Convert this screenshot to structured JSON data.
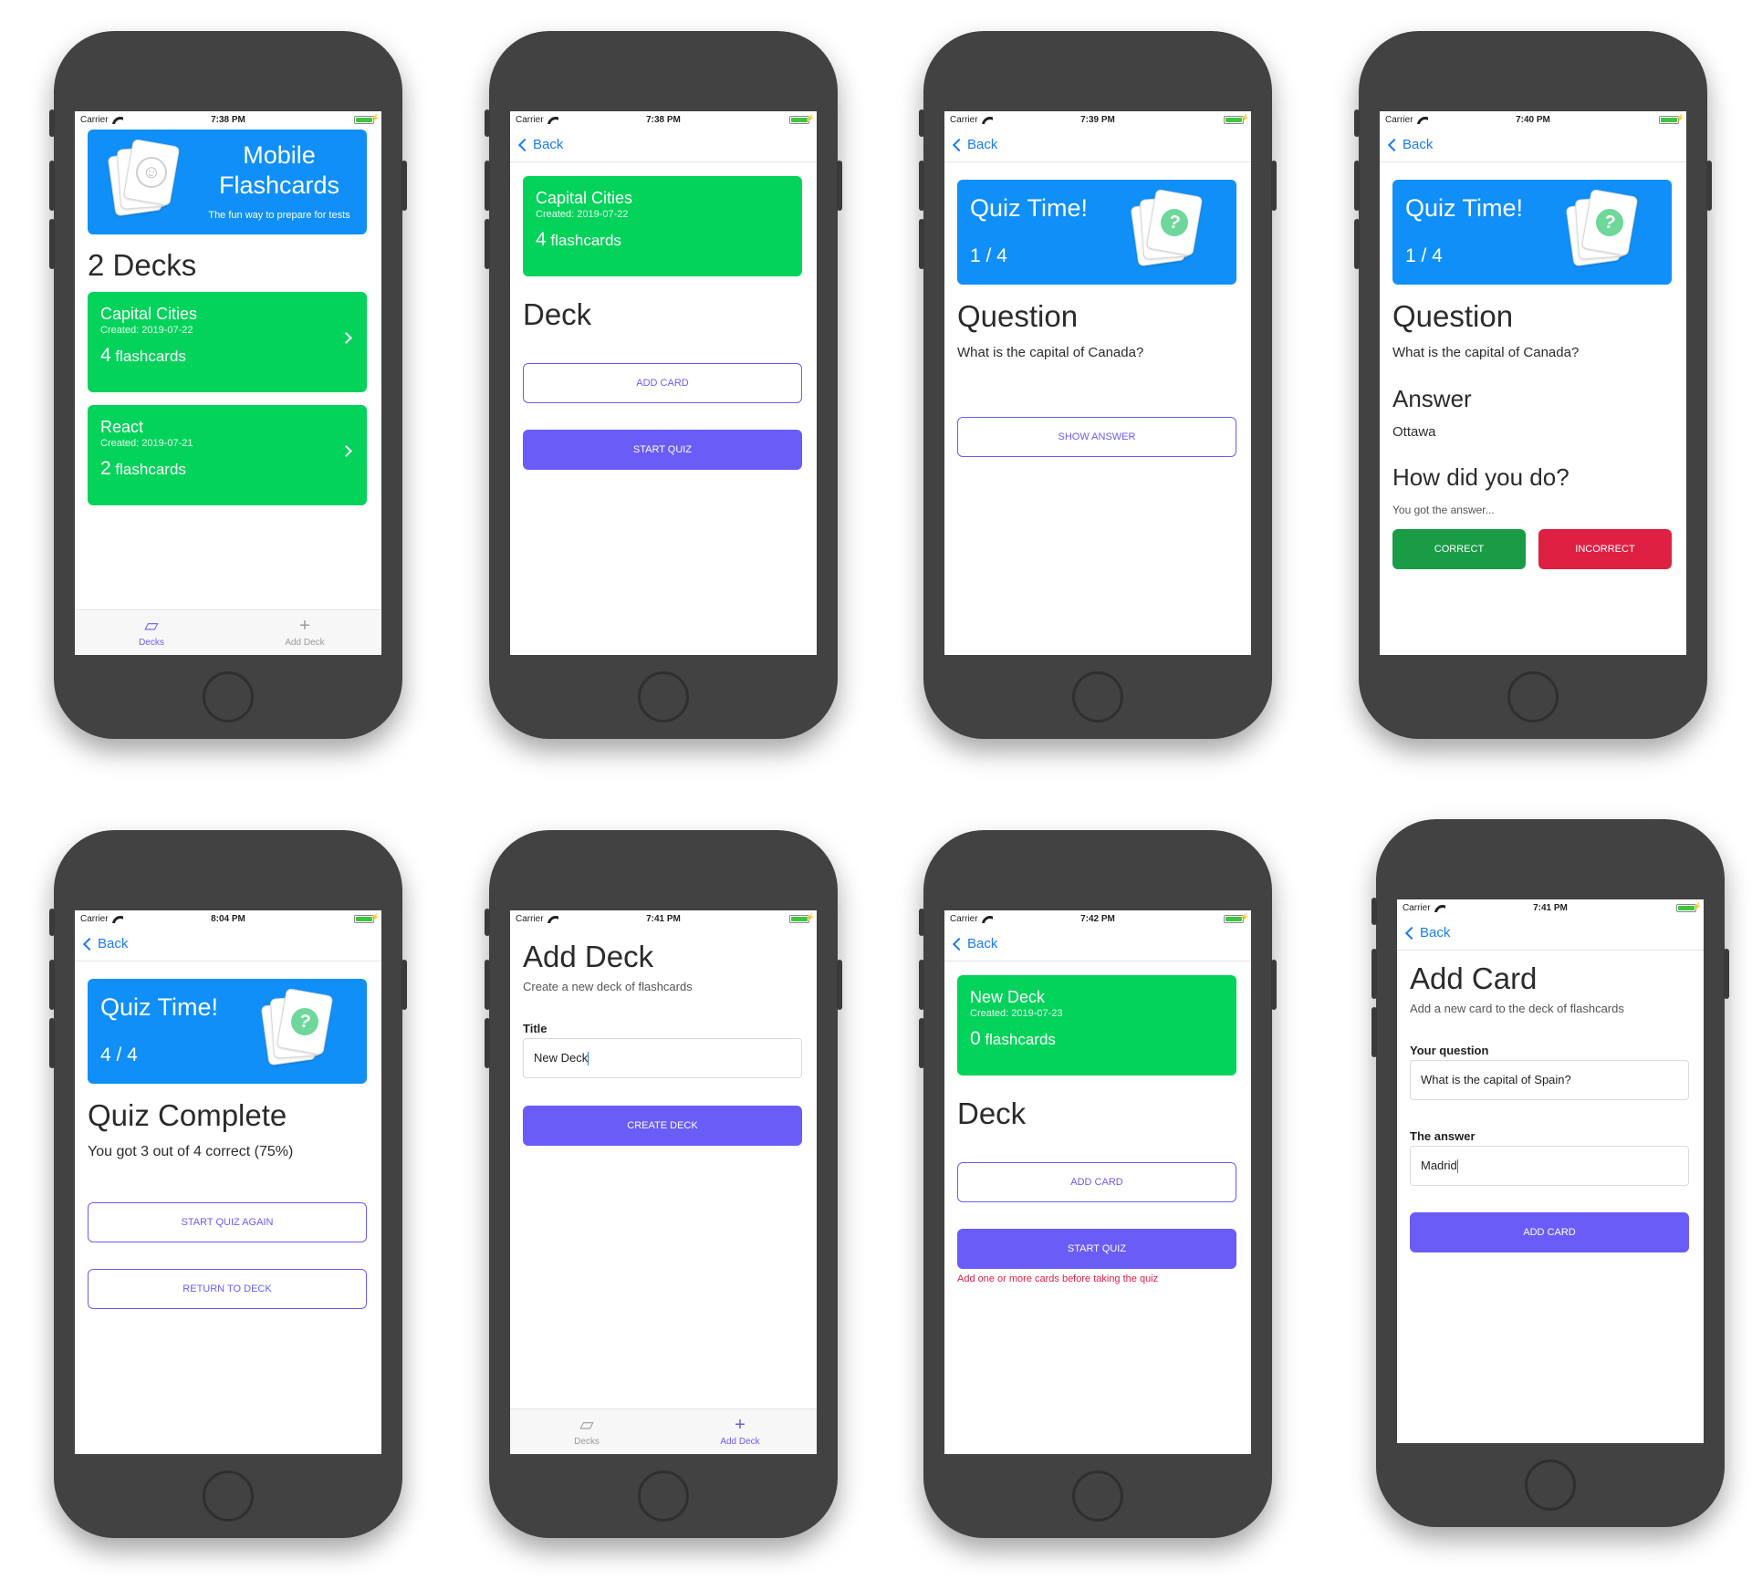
{
  "colors": {
    "accent": "#6a5cf7",
    "blue": "#0f8ff7",
    "green": "#03d35a",
    "link": "#1a7cf5",
    "correct": "#1a9c46",
    "incorrect": "#de2043"
  },
  "common": {
    "carrier": "Carrier",
    "back": "Back",
    "tabs": {
      "decks": "Decks",
      "add_deck": "Add Deck"
    }
  },
  "screen1": {
    "time": "7:38 PM",
    "banner": {
      "title": "Mobile Flashcards",
      "tagline": "The fun way to prepare for tests"
    },
    "heading": "2 Decks",
    "decks": [
      {
        "title": "Capital Cities",
        "created": "Created: 2019-07-22",
        "count": "4",
        "unit": "flashcards"
      },
      {
        "title": "React",
        "created": "Created: 2019-07-21",
        "count": "2",
        "unit": "flashcards"
      }
    ]
  },
  "screen2": {
    "time": "7:38 PM",
    "deck": {
      "title": "Capital Cities",
      "created": "Created: 2019-07-22",
      "count": "4",
      "unit": "flashcards"
    },
    "heading": "Deck",
    "add_card": "ADD CARD",
    "start_quiz": "START QUIZ"
  },
  "screen3": {
    "time": "7:39 PM",
    "quiz_title": "Quiz Time!",
    "progress": "1 / 4",
    "question_heading": "Question",
    "question": "What is the capital of Canada?",
    "show_answer": "SHOW ANSWER"
  },
  "screen4": {
    "time": "7:40 PM",
    "quiz_title": "Quiz Time!",
    "progress": "1 / 4",
    "question_heading": "Question",
    "question": "What is the capital of Canada?",
    "answer_heading": "Answer",
    "answer": "Ottawa",
    "how_heading": "How did you do?",
    "how_sub": "You got the answer...",
    "correct": "CORRECT",
    "incorrect": "INCORRECT"
  },
  "screen5": {
    "time": "8:04 PM",
    "quiz_title": "Quiz Time!",
    "progress": "4 / 4",
    "heading": "Quiz Complete",
    "result": "You got 3 out of 4 correct (75%)",
    "start_again": "START QUIZ AGAIN",
    "return_deck": "RETURN TO DECK"
  },
  "screen6": {
    "time": "7:41 PM",
    "heading": "Add Deck",
    "sub": "Create a new deck of flashcards",
    "title_label": "Title",
    "title_value": "New Deck",
    "create": "CREATE DECK"
  },
  "screen7": {
    "time": "7:42 PM",
    "deck": {
      "title": "New Deck",
      "created": "Created: 2019-07-23",
      "count": "0",
      "unit": "flashcards"
    },
    "heading": "Deck",
    "add_card": "ADD CARD",
    "start_quiz": "START QUIZ",
    "error": "Add one or more cards before taking the quiz"
  },
  "screen8": {
    "time": "7:41 PM",
    "heading": "Add Card",
    "sub": "Add a new card to the deck of flashcards",
    "question_label": "Your question",
    "question_value": "What is the capital of Spain?",
    "answer_label": "The answer",
    "answer_value": "Madrid",
    "add_card": "ADD CARD"
  }
}
